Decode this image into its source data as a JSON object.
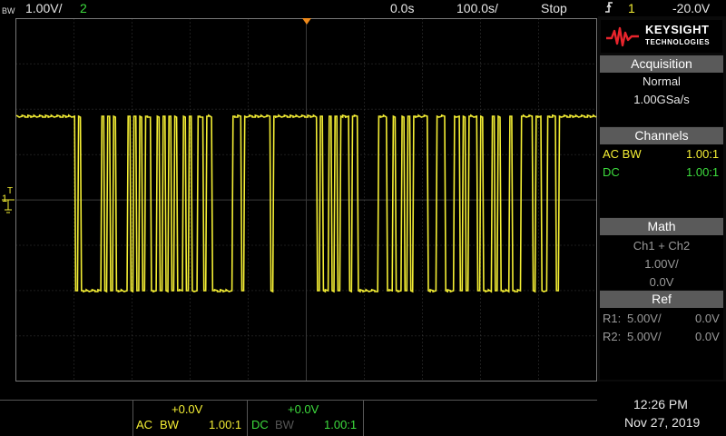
{
  "topbar": {
    "bw_label": "BW",
    "ch1_scale": "1.00V/",
    "ch2_number": "2",
    "time_pos": "0.0s",
    "time_scale": "100.0s/",
    "run_state": "Stop",
    "trigger_icon": "trigger-edge-icon",
    "trigger_channel": "1",
    "trigger_level": "-20.0V"
  },
  "panel": {
    "logo_line1": "KEYSIGHT",
    "logo_line2": "TECHNOLOGIES",
    "acquisition": {
      "title": "Acquisition",
      "mode": "Normal",
      "rate": "1.00GSa/s"
    },
    "channels": {
      "title": "Channels",
      "rows": [
        {
          "coupling": "AC BW",
          "probe": "1.00:1"
        },
        {
          "coupling": "DC",
          "probe": "1.00:1"
        }
      ]
    },
    "math": {
      "title": "Math",
      "expr": "Ch1 + Ch2",
      "scale": "1.00V/",
      "offset": "0.0V"
    },
    "ref": {
      "title": "Ref",
      "rows": [
        {
          "name": "R1:",
          "scale": "5.00V/",
          "offset": "0.0V"
        },
        {
          "name": "R2:",
          "scale": "5.00V/",
          "offset": "0.0V"
        }
      ]
    }
  },
  "bottom": {
    "ch1": {
      "offset": "+0.0V",
      "coupling": "AC",
      "bw": "BW",
      "probe": "1.00:1"
    },
    "ch2": {
      "offset": "+0.0V",
      "coupling": "DC",
      "bw": "BW",
      "probe": "1.00:1"
    },
    "time": "12:26 PM",
    "date": "Nov 27, 2019"
  },
  "graticule": {
    "ch1_marker": "1",
    "trigger_marker": "T"
  },
  "colors": {
    "ch1": "#f4ee34",
    "ch2": "#3ddc3d",
    "panel_header": "#5a5a5a",
    "grid": "#444444"
  },
  "waveform_bits": "1111111111111111111101000000010101000010101011001010101001010011011000000011101111111110111111111111111010010101110110000000111001001010111110001110001101011101000101000100011110110011101111111111111"
}
